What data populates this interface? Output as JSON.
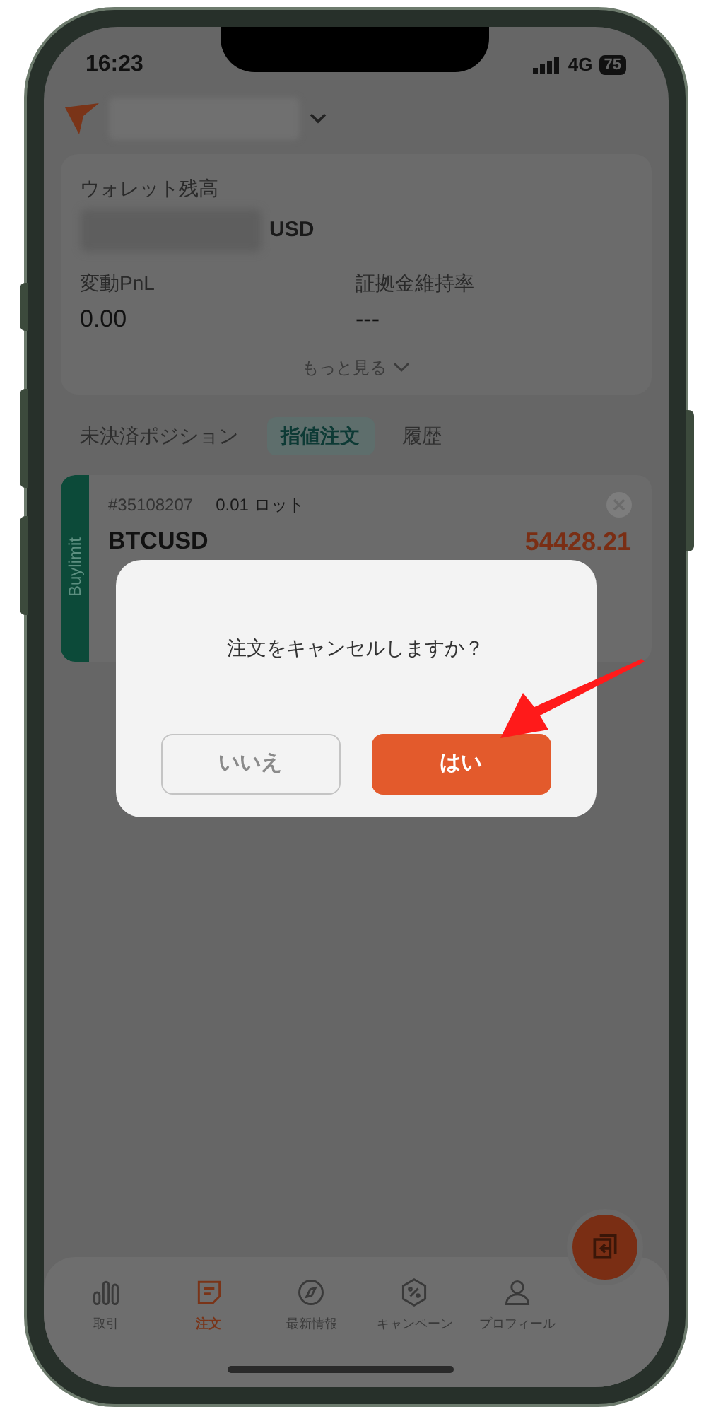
{
  "status_bar": {
    "time": "16:23",
    "network": "4G",
    "battery": "75"
  },
  "wallet": {
    "label": "ウォレット残高",
    "currency": "USD",
    "stats": [
      {
        "label": "変動PnL",
        "value": "0.00"
      },
      {
        "label": "証拠金維持率",
        "value": "---"
      }
    ],
    "more": "もっと見る"
  },
  "tabs": [
    {
      "label": "未決済ポジション",
      "selected": false
    },
    {
      "label": "指値注文",
      "selected": true
    },
    {
      "label": "履歴",
      "selected": false
    }
  ],
  "order": {
    "side": "Buylimit",
    "id": "#35108207",
    "lots": "0.01 ロット",
    "symbol": "BTCUSD",
    "price": "54428.21"
  },
  "dialog": {
    "message": "注文をキャンセルしますか？",
    "buttons": [
      {
        "label": "いいえ",
        "kind": "secondary"
      },
      {
        "label": "はい",
        "kind": "primary"
      }
    ]
  },
  "nav": [
    {
      "label": "取引",
      "kind": "chart",
      "selected": false
    },
    {
      "label": "注文",
      "kind": "note",
      "selected": true
    },
    {
      "label": "最新情報",
      "kind": "compass",
      "selected": false
    },
    {
      "label": "キャンペーン",
      "kind": "percent",
      "selected": false
    },
    {
      "label": "プロフィール",
      "kind": "person",
      "selected": false
    }
  ]
}
